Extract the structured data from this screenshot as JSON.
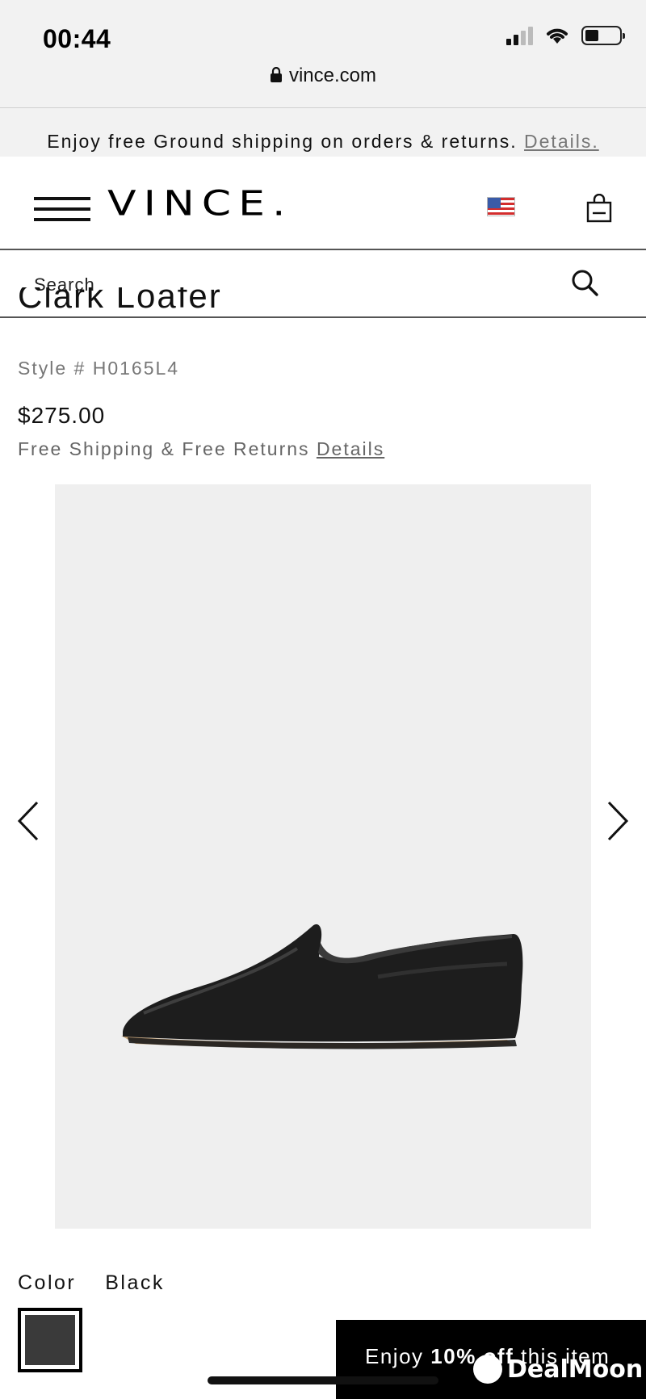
{
  "status_bar": {
    "time": "00:44",
    "url": "vince.com",
    "battery_level": 0.4
  },
  "promo": {
    "text": "Enjoy free Ground shipping on orders & returns.",
    "link": "Details."
  },
  "header": {
    "logo": "VINCE.",
    "flag_icon": "us-flag-icon",
    "bag_icon": "shopping-bag-icon",
    "menu_icon": "hamburger-menu-icon"
  },
  "search": {
    "placeholder": "Search",
    "icon": "search-icon"
  },
  "product": {
    "title": "Clark Loafer",
    "style": "Style # H0165L4",
    "price": "$275.00",
    "shipping_text": "Free Shipping & Free Returns",
    "shipping_link": "Details",
    "image_alt": "Black leather loafer",
    "prev_icon": "chevron-left-icon",
    "next_icon": "chevron-right-icon"
  },
  "color": {
    "label": "Color",
    "value": "Black",
    "swatch_color": "#3a3a3a"
  },
  "offer": {
    "prefix": "Enjoy",
    "highlight": "10% off",
    "suffix": "this item"
  },
  "watermark": {
    "text": "DealMoon"
  },
  "colors": {
    "chrome_bg": "#f2f2f2",
    "image_bg": "#efefef",
    "offer_bg": "#000000"
  }
}
